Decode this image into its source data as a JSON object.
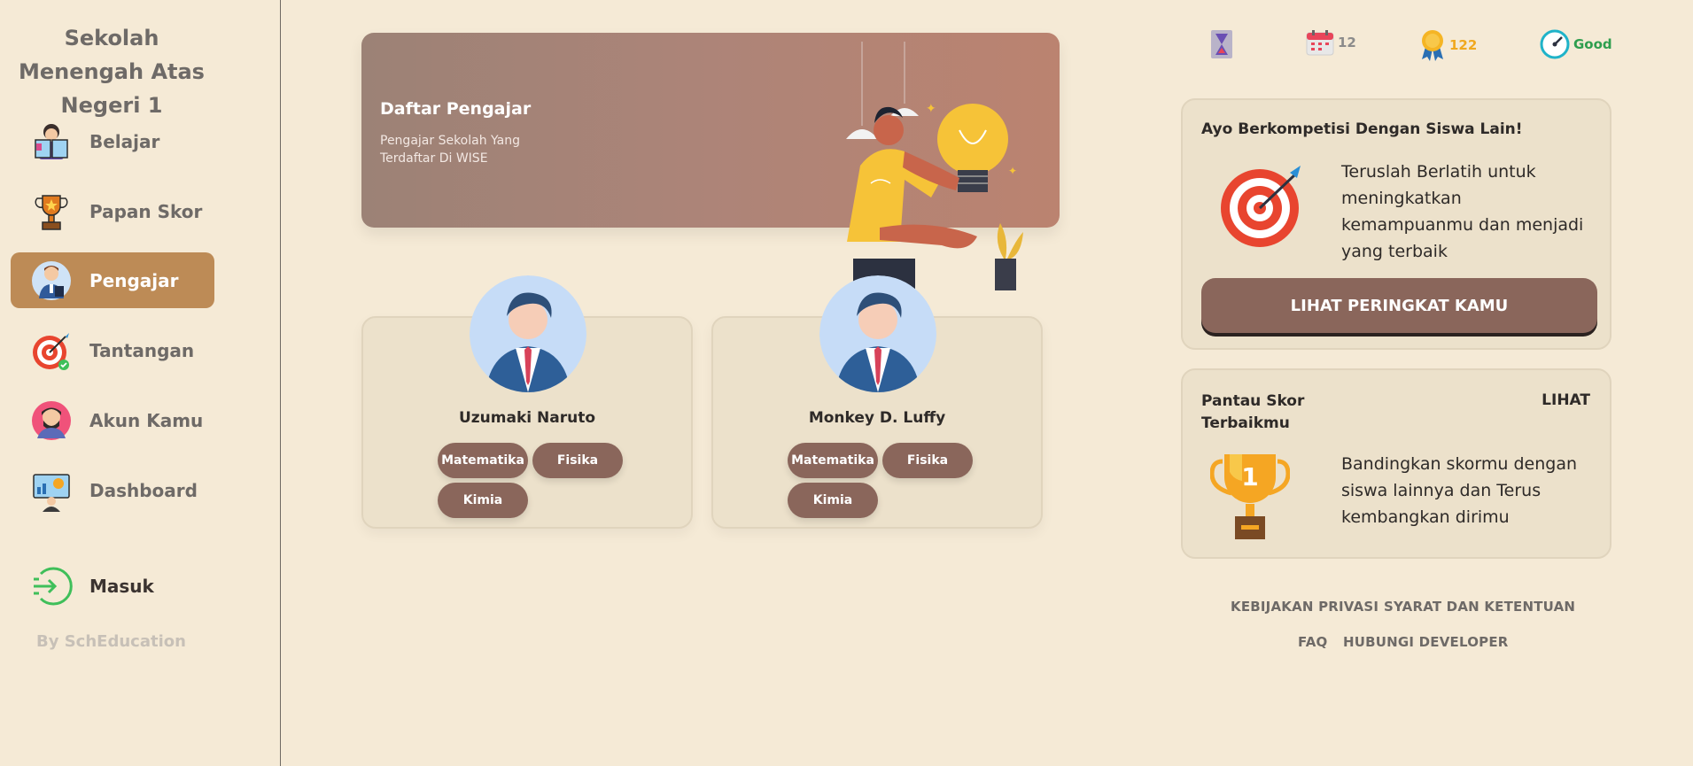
{
  "sidebar": {
    "school_name": "Sekolah Menengah Atas Negeri 1",
    "items": [
      {
        "label": "Belajar",
        "icon": "student-reading-icon"
      },
      {
        "label": "Papan Skor",
        "icon": "trophy-icon"
      },
      {
        "label": "Pengajar",
        "icon": "teacher-icon",
        "active": true
      },
      {
        "label": "Tantangan",
        "icon": "target-icon"
      },
      {
        "label": "Akun Kamu",
        "icon": "user-avatar-icon"
      },
      {
        "label": "Dashboard",
        "icon": "dashboard-icon"
      }
    ],
    "login_label": "Masuk",
    "by_label": "By SchEducation"
  },
  "banner": {
    "title": "Daftar Pengajar",
    "subtitle": "Pengajar Sekolah Yang Terdaftar Di WISE"
  },
  "teachers": [
    {
      "name": "Uzumaki Naruto",
      "subjects": [
        "Matematika",
        "Fisika",
        "Kimia"
      ]
    },
    {
      "name": "Monkey D. Luffy",
      "subjects": [
        "Matematika",
        "Fisika",
        "Kimia"
      ]
    }
  ],
  "stats": {
    "calendar_value": "12",
    "medal_value": "122",
    "speed_value": "Good"
  },
  "compete_card": {
    "title": "Ayo Berkompetisi Dengan Siswa Lain!",
    "text": "Teruslah Berlatih untuk meningkatkan kemampuanmu dan menjadi yang terbaik",
    "button_label": "LIHAT PERINGKAT KAMU"
  },
  "score_card": {
    "title": "Pantau Skor Terbaikmu",
    "link_label": "LIHAT",
    "text": "Bandingkan skormu dengan siswa lainnya dan Terus kembangkan dirimu"
  },
  "footer": {
    "privacy": "KEBIJAKAN PRIVASI",
    "terms": "SYARAT DAN KETENTUAN",
    "faq": "FAQ",
    "contact": "HUBUNGI DEVELOPER"
  },
  "colors": {
    "background": "#f5ead6",
    "active_nav": "#bd8b56",
    "pill": "#8a665b",
    "medal_text": "#f0a81e",
    "good_text": "#2e9e4e"
  }
}
